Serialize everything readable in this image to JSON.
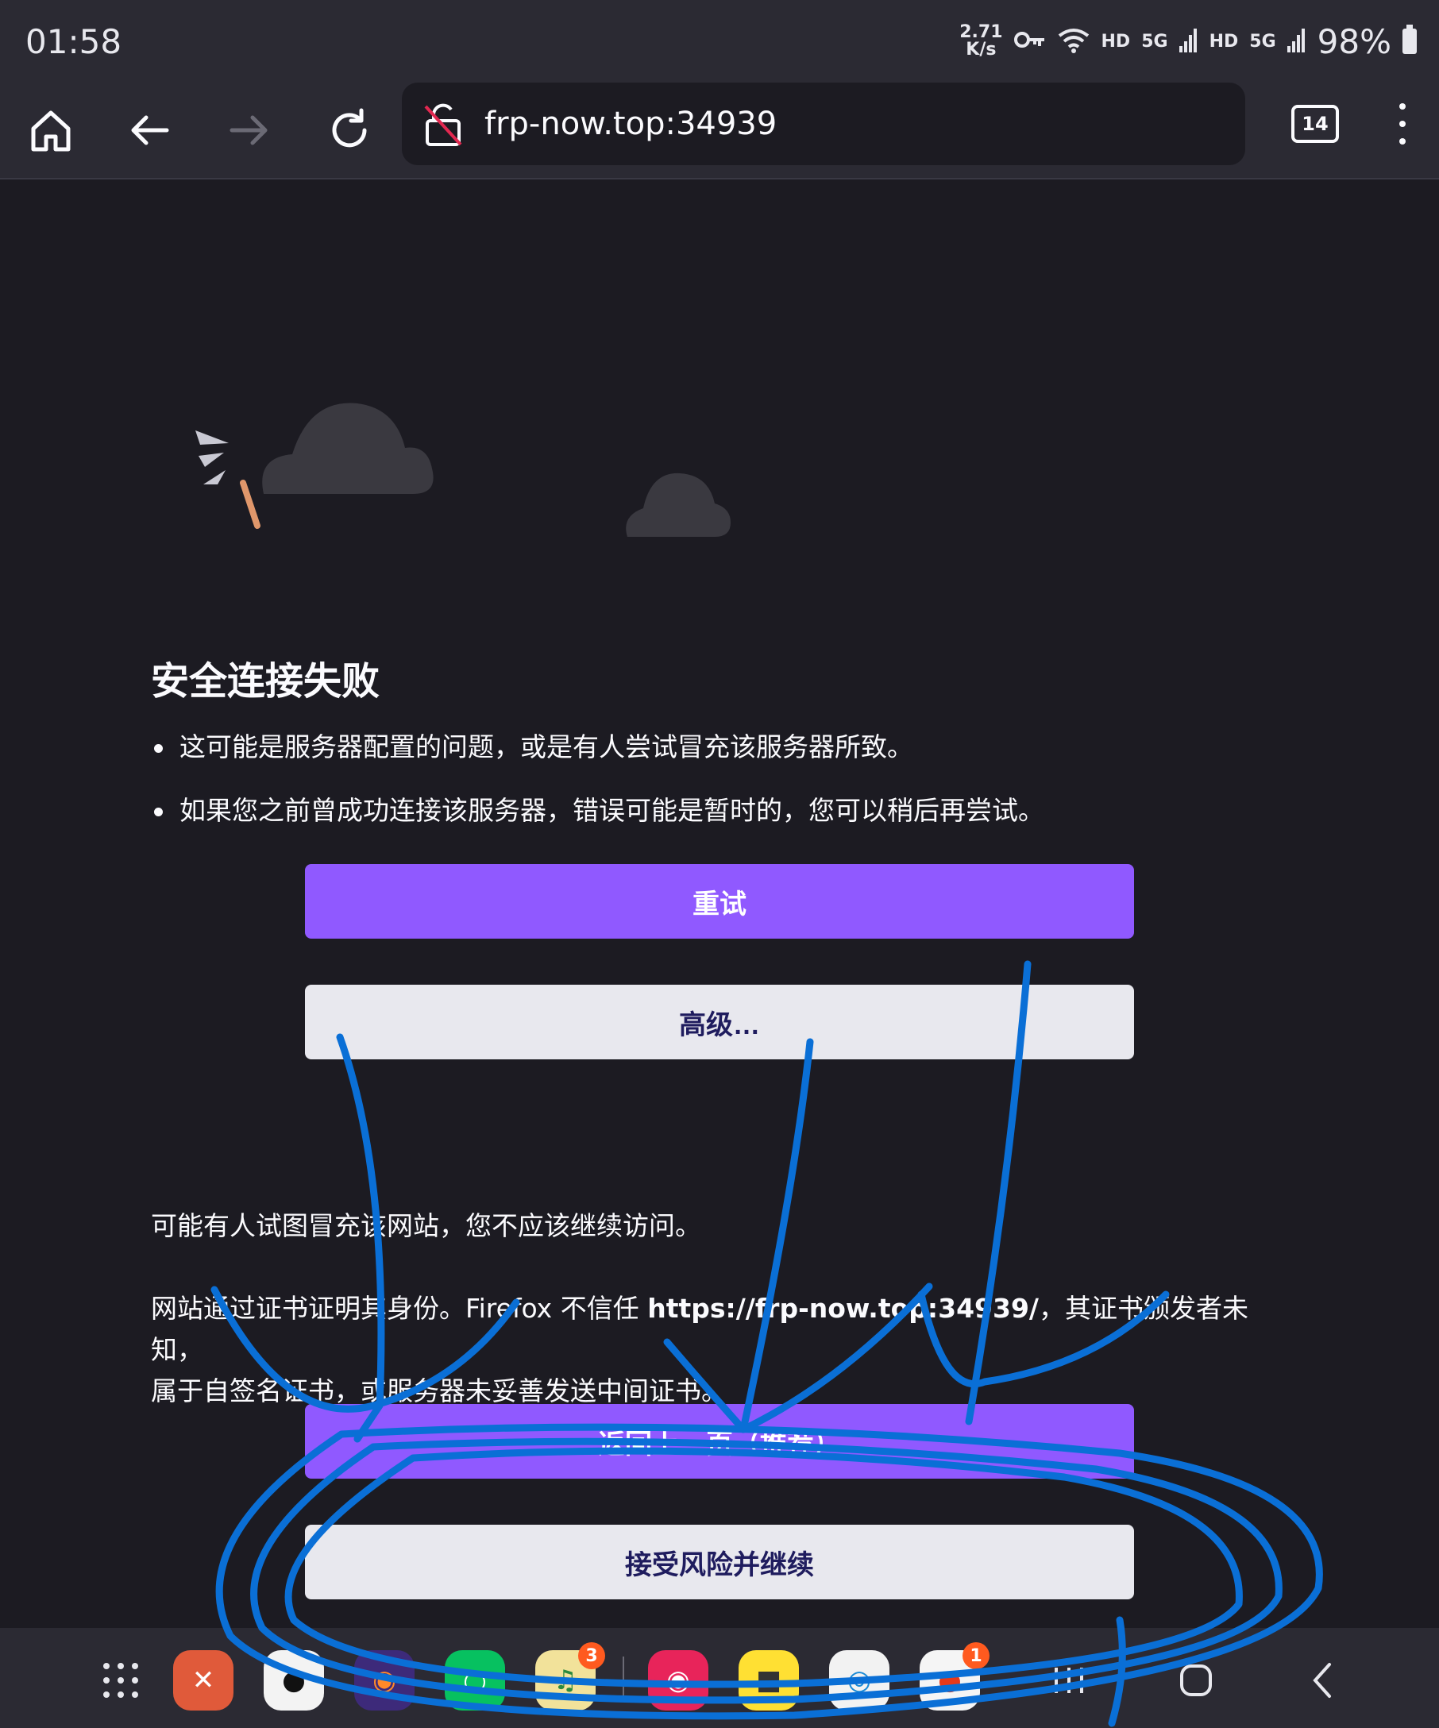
{
  "status_bar": {
    "time": "01:58",
    "net_speed_value": "2.71",
    "net_speed_unit": "K/s",
    "hd1": "HD",
    "net1": "5G",
    "hd2": "HD",
    "net2": "5G",
    "battery": "98%"
  },
  "toolbar": {
    "url": "frp-now.top:34939",
    "tab_count": "14"
  },
  "error_page": {
    "title": "安全连接失败",
    "bullets": [
      "这可能是服务器配置的问题，或是有人尝试冒充该服务器所致。",
      "如果您之前曾成功连接该服务器，错误可能是暂时的，您可以稍后再尝试。"
    ],
    "retry_label": "重试",
    "advanced_label": "高级…",
    "warning_text": "可能有人试图冒充该网站，您不应该继续访问。",
    "cert_text_1": "网站通过证书证明其身份。Firefox 不信任 ",
    "cert_url": "https://frp-now.top:34939/",
    "cert_text_2": "，其证书颁发者未知，",
    "cert_text_3": "属于自签名证书，或服务器未妥善发送中间证书。",
    "go_back_label": "返回上一页（推荐）",
    "accept_label": "接受风险并继续"
  },
  "taskbar": {
    "badge_app3": "3",
    "badge_app8": "1",
    "icons": [
      "apps-grid-icon",
      "remote-desktop-icon",
      "qq-icon",
      "firefox-icon",
      "wechat-icon",
      "music-icon",
      "camera-icon",
      "xianyu-icon",
      "edge-icon",
      "taobao-icon",
      "recents-icon",
      "home-icon",
      "back-icon"
    ]
  },
  "colors": {
    "primary_button": "#9059ff",
    "secondary_button": "#e8e8ee",
    "page_bg": "#1c1b22",
    "toolbar_bg": "#2b2a33",
    "scribble": "#0a6fd6"
  }
}
